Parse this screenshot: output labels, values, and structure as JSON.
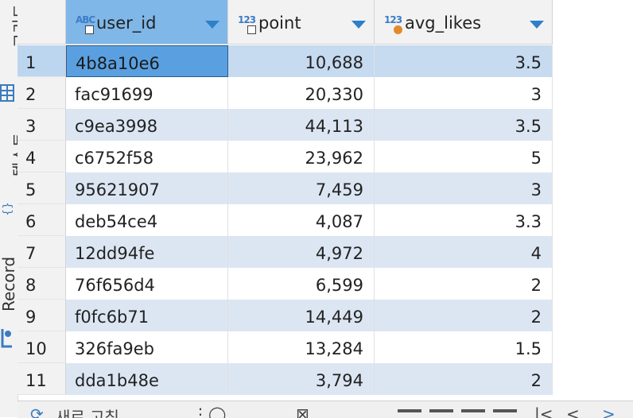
{
  "sidebar": {
    "label_top": "그리드",
    "label_mid": "텍스트",
    "label_record": "Record"
  },
  "columns": [
    {
      "name": "user_id",
      "type_icon": "abc-key",
      "type_text": "ABC"
    },
    {
      "name": "point",
      "type_icon": "123-key",
      "type_text": "123"
    },
    {
      "name": "avg_likes",
      "type_icon": "123-dot",
      "type_text": "123"
    }
  ],
  "rows": [
    {
      "n": "1",
      "user_id": "4b8a10e6",
      "point": "10,688",
      "avg_likes": "3.5"
    },
    {
      "n": "2",
      "user_id": "fac91699",
      "point": "20,330",
      "avg_likes": "3"
    },
    {
      "n": "3",
      "user_id": "c9ea3998",
      "point": "44,113",
      "avg_likes": "3.5"
    },
    {
      "n": "4",
      "user_id": "c6752f58",
      "point": "23,962",
      "avg_likes": "5"
    },
    {
      "n": "5",
      "user_id": "95621907",
      "point": "7,459",
      "avg_likes": "3"
    },
    {
      "n": "6",
      "user_id": "deb54ce4",
      "point": "4,087",
      "avg_likes": "3.3"
    },
    {
      "n": "7",
      "user_id": "12dd94fe",
      "point": "4,972",
      "avg_likes": "4"
    },
    {
      "n": "8",
      "user_id": "76f656d4",
      "point": "6,599",
      "avg_likes": "2"
    },
    {
      "n": "9",
      "user_id": "f0fc6b71",
      "point": "14,449",
      "avg_likes": "2"
    },
    {
      "n": "10",
      "user_id": "326fa9eb",
      "point": "13,284",
      "avg_likes": "1.5"
    },
    {
      "n": "11",
      "user_id": "dda1b48e",
      "point": "3,794",
      "avg_likes": "2"
    }
  ],
  "toolbar": {
    "refresh_label": "새로 고침"
  },
  "colors": {
    "selected_header": "#7fb7e8",
    "selected_cell": "#5aa0e0",
    "alt_row": "#dce6f3"
  }
}
